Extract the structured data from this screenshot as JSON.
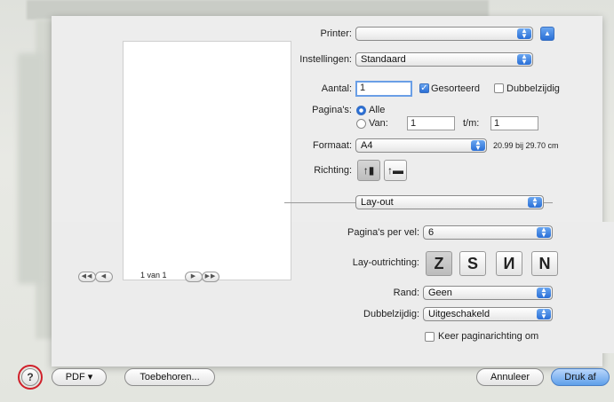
{
  "printer": {
    "label": "Printer:",
    "value": ""
  },
  "presets": {
    "label": "Instellingen:",
    "value": "Standaard"
  },
  "copies": {
    "label": "Aantal:",
    "value": "1",
    "collated_label": "Gesorteerd",
    "collated": true,
    "duplex_label": "Dubbelzijdig",
    "duplex": false
  },
  "pages": {
    "label": "Pagina's:",
    "all_label": "Alle",
    "from_label": "Van:",
    "from_value": "1",
    "to_label": "t/m:",
    "to_value": "1",
    "selected": "all"
  },
  "paper": {
    "label": "Formaat:",
    "value": "A4",
    "size_text": "20.99 bij 29.70 cm"
  },
  "orientation": {
    "label": "Richting:",
    "selected": "portrait"
  },
  "section": {
    "value": "Lay-out"
  },
  "layout": {
    "pages_per_sheet_label": "Pagina's per vel:",
    "pages_per_sheet": "6",
    "direction_label": "Lay-outrichting:",
    "border_label": "Rand:",
    "border": "Geen",
    "two_sided_label": "Dubbelzijdig:",
    "two_sided": "Uitgeschakeld",
    "reverse_label": "Keer paginarichting om",
    "reverse": false
  },
  "preview": {
    "page_indicator": "1 van 1"
  },
  "footer": {
    "help": "?",
    "pdf": "PDF ▾",
    "accessories": "Toebehoren...",
    "cancel": "Annuleer",
    "print": "Druk af"
  },
  "icons": {
    "help": "help-icon",
    "disclosure": "disclosure-up-icon"
  },
  "colors": {
    "accent": "#2a6fd6",
    "highlight": "#d0202a"
  }
}
